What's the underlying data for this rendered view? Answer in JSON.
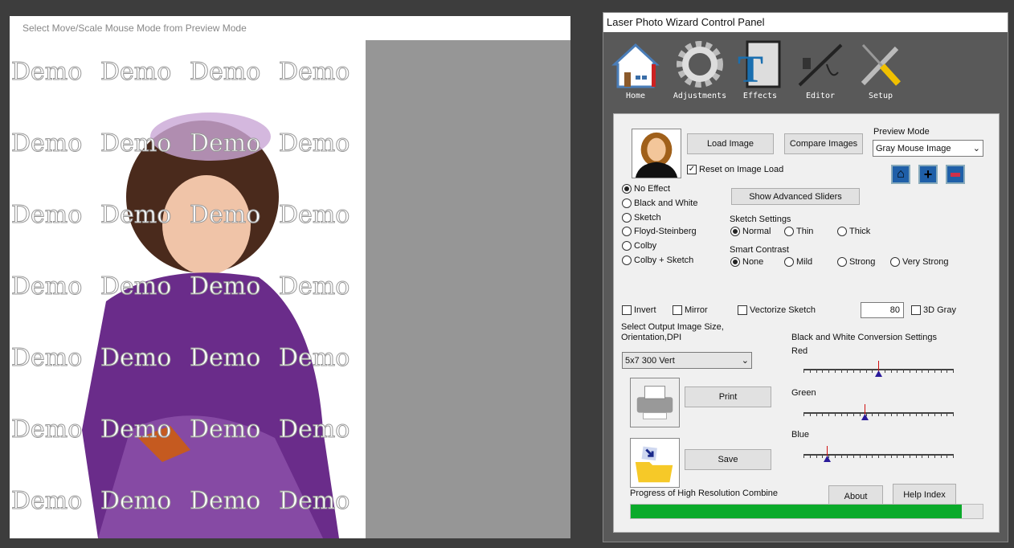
{
  "preview": {
    "hint": "Select Move/Scale Mouse Mode from Preview Mode",
    "watermark": "Demo"
  },
  "window": {
    "title": "Laser Photo Wizard Control Panel"
  },
  "toolbar": [
    {
      "label": "Home",
      "icon": "house-icon"
    },
    {
      "label": "Adjustments",
      "icon": "gear-icon"
    },
    {
      "label": "Effects",
      "icon": "text-effects-icon"
    },
    {
      "label": "Editor",
      "icon": "airbrush-icon"
    },
    {
      "label": "Setup",
      "icon": "tools-icon"
    }
  ],
  "panel": {
    "load_image": "Load Image",
    "compare_images": "Compare Images",
    "preview_mode_label": "Preview Mode",
    "preview_mode_value": "Gray Mouse Image",
    "reset_on_load": "Reset on Image Load",
    "reset_on_load_checked": true,
    "show_advanced": "Show Advanced Sliders",
    "effects": [
      {
        "label": "No Effect",
        "selected": true
      },
      {
        "label": "Black and White",
        "selected": false
      },
      {
        "label": "Sketch",
        "selected": false
      },
      {
        "label": "Floyd-Steinberg",
        "selected": false
      },
      {
        "label": "Colby",
        "selected": false
      },
      {
        "label": "Colby + Sketch",
        "selected": false
      }
    ],
    "sketch_settings": {
      "label": "Sketch Settings",
      "options": [
        {
          "label": "Normal",
          "selected": true
        },
        {
          "label": "Thin",
          "selected": false
        },
        {
          "label": "Thick",
          "selected": false
        }
      ]
    },
    "smart_contrast": {
      "label": "Smart Contrast",
      "options": [
        {
          "label": "None",
          "selected": true
        },
        {
          "label": "Mild",
          "selected": false
        },
        {
          "label": "Strong",
          "selected": false
        },
        {
          "label": "Very Strong",
          "selected": false
        }
      ]
    },
    "invert": "Invert",
    "mirror": "Mirror",
    "vectorize": "Vectorize Sketch",
    "value_box": "80",
    "gray3d": "3D Gray",
    "output_label": "Select Output Image Size, Orientation,DPI",
    "output_value": "5x7 300 Vert",
    "bw_label": "Black and White Conversion Settings",
    "sliders": [
      {
        "label": "Red",
        "value": 0.5
      },
      {
        "label": "Green",
        "value": 0.41
      },
      {
        "label": "Blue",
        "value": 0.16
      }
    ],
    "print": "Print",
    "save": "Save",
    "about": "About",
    "help": "Help Index",
    "progress_label": "Progress of High Resolution Combine",
    "progress": 0.94,
    "progress_color": "#0aaa2a"
  }
}
